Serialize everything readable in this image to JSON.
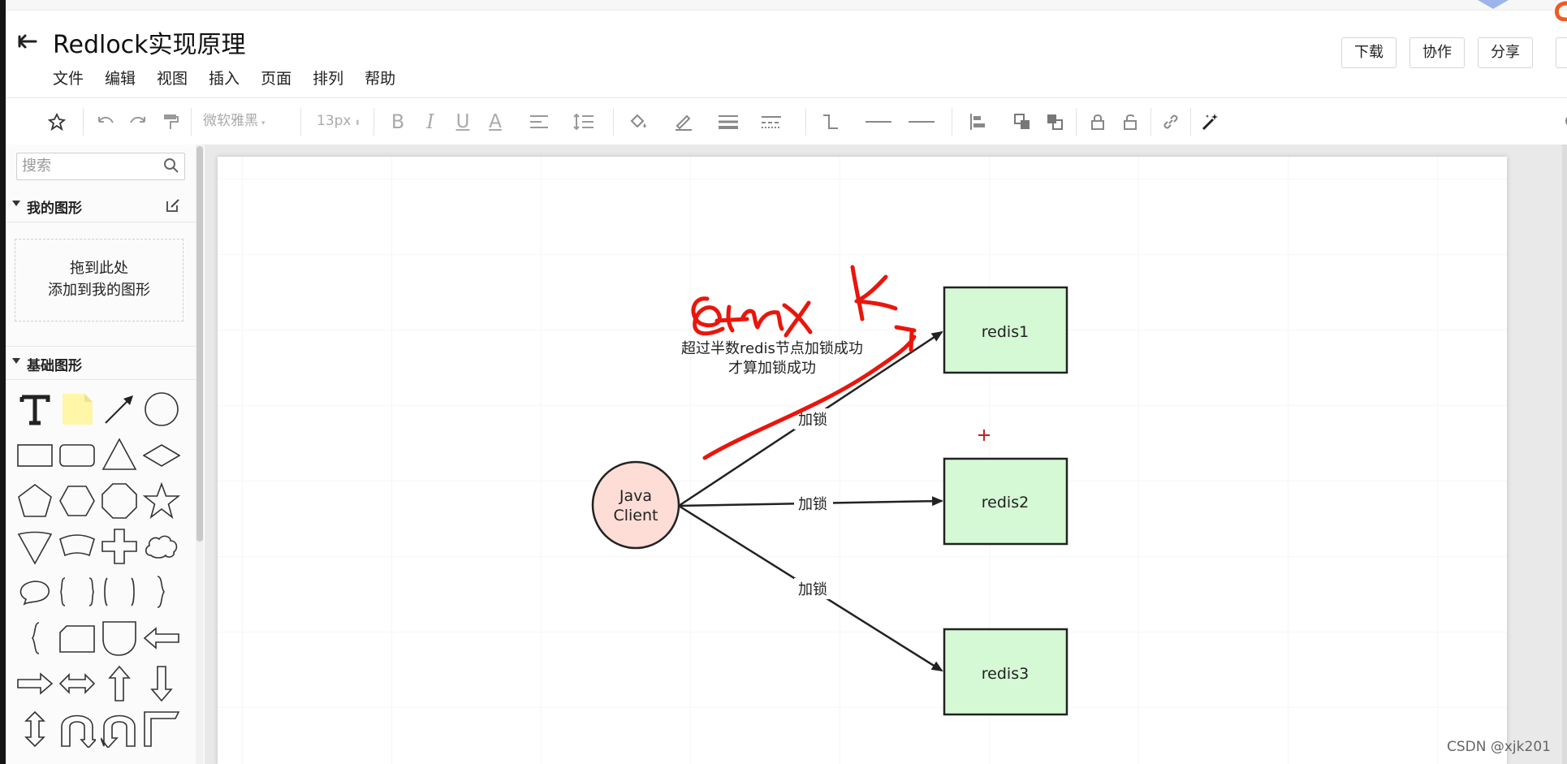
{
  "header": {
    "title": "Redlock实现原理",
    "menu": [
      "文件",
      "编辑",
      "视图",
      "插入",
      "页面",
      "排列",
      "帮助"
    ],
    "buttons": [
      "下载",
      "协作",
      "分享"
    ]
  },
  "toolbar": {
    "font_family": "微软雅黑",
    "font_size": "13px",
    "bold": "B",
    "italic": "I",
    "underline": "U",
    "font_color": "A"
  },
  "sidebar": {
    "search_placeholder": "搜索",
    "my_shapes_title": "我的图形",
    "drop_line1": "拖到此处",
    "drop_line2": "添加到我的图形",
    "basic_shapes_title": "基础图形"
  },
  "diagram": {
    "client_line1": "Java",
    "client_line2": "Client",
    "nodes": [
      "redis1",
      "redis2",
      "redis3"
    ],
    "edge_labels": [
      "加锁",
      "加锁",
      "加锁"
    ],
    "note_line1": "超过半数redis节点加锁成功",
    "note_line2": "才算加锁成功",
    "colors": {
      "client_fill": "#fdddd6",
      "node_fill": "#d5f8d5",
      "annotation": "#e8160c"
    }
  },
  "watermark": "CSDN @xjk201"
}
